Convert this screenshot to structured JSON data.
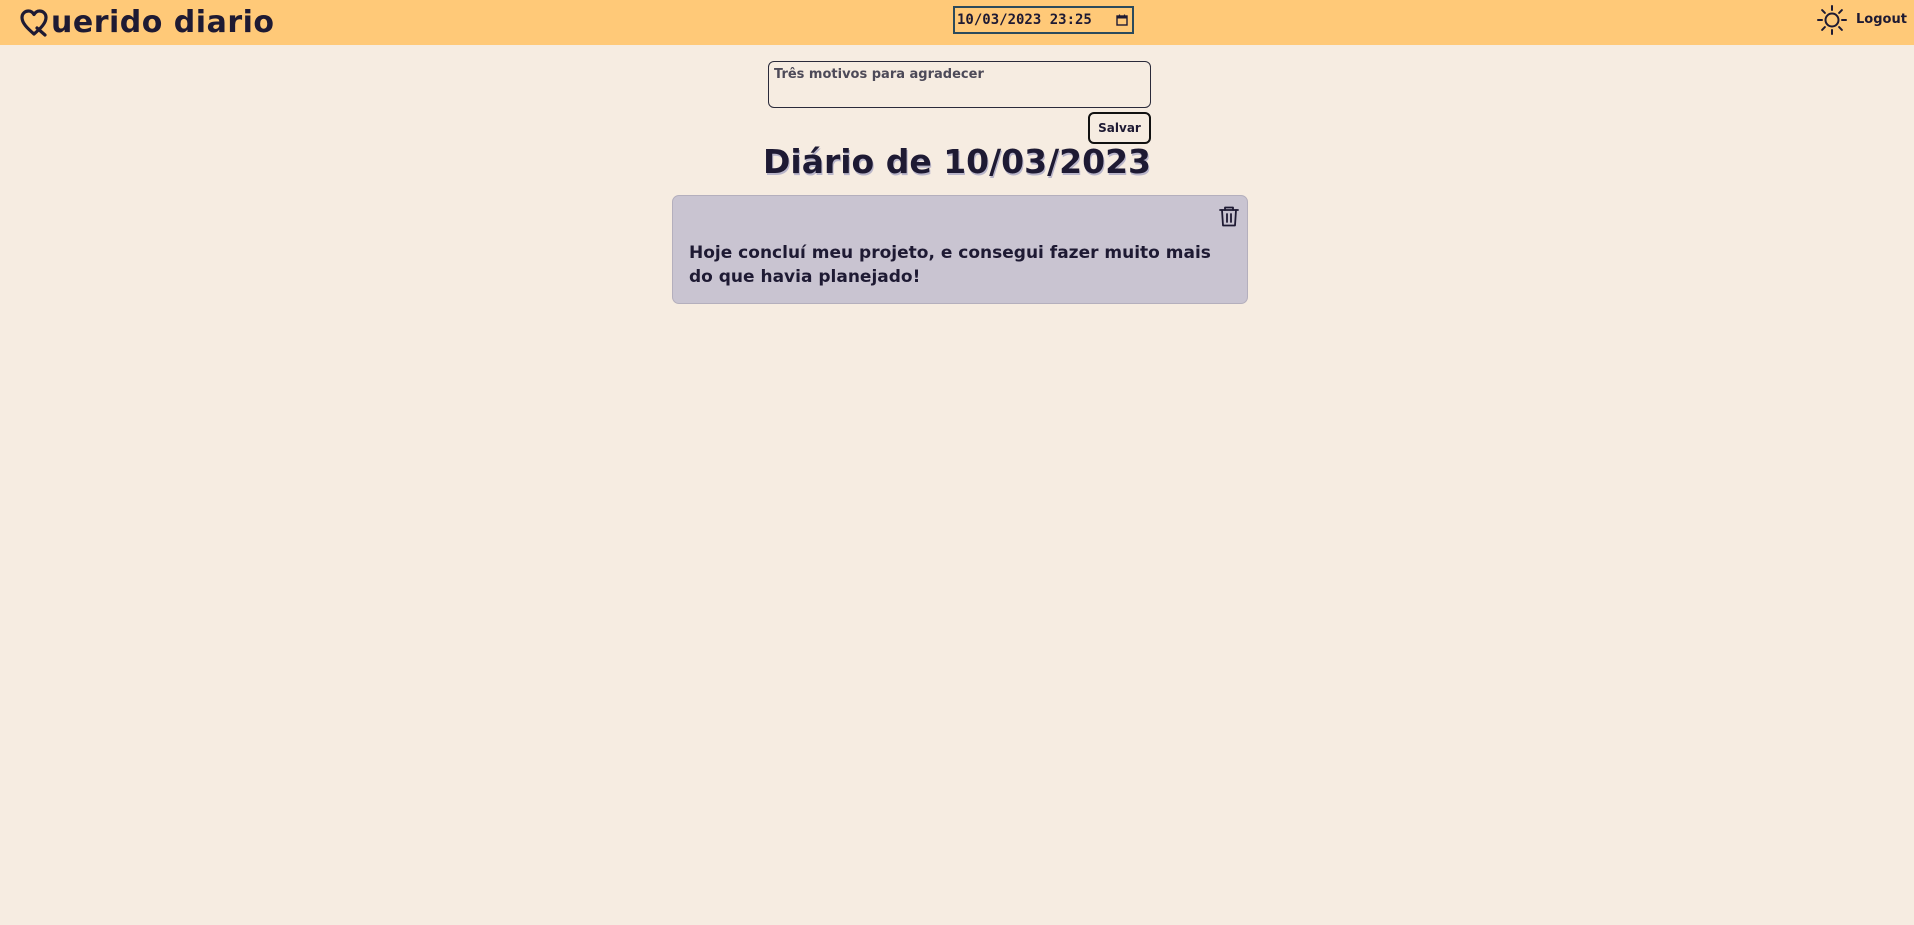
{
  "app": {
    "logo_icon": "heart-q-icon",
    "title": "uerido diario"
  },
  "header": {
    "datetime_value": "10/03/2023 23:25",
    "calendar_icon": "calendar-icon",
    "theme_icon": "sun-icon",
    "logout_label": "Logout"
  },
  "composer": {
    "placeholder": "Três motivos para agradecer",
    "value": "",
    "save_label": "Salvar"
  },
  "diary": {
    "title": "Diário de 10/03/2023",
    "entries": [
      {
        "text": "Hoje concluí meu projeto, e consegui fazer muito mais do que havia planejado!",
        "delete_icon": "trash-icon"
      }
    ]
  },
  "colors": {
    "header_bg": "#ffc978",
    "page_bg": "#f6ece1",
    "card_bg": "#c9c4d1",
    "text": "#1e1a33"
  }
}
